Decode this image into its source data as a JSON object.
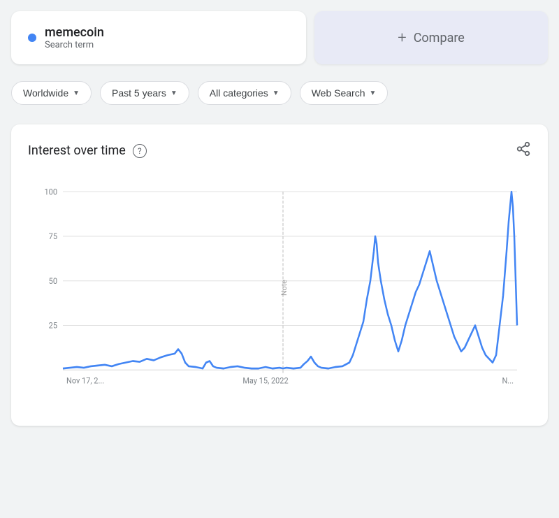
{
  "search_term": {
    "name": "memecoin",
    "label": "Search term",
    "dot_color": "#4285f4"
  },
  "compare": {
    "label": "Compare",
    "plus": "+"
  },
  "filters": [
    {
      "id": "worldwide",
      "label": "Worldwide"
    },
    {
      "id": "past5years",
      "label": "Past 5 years"
    },
    {
      "id": "allcategories",
      "label": "All categories"
    },
    {
      "id": "websearch",
      "label": "Web Search"
    }
  ],
  "chart": {
    "title": "Interest over time",
    "help_label": "?",
    "share_icon": "share",
    "y_labels": [
      "100",
      "75",
      "50",
      "25"
    ],
    "x_labels": [
      "Nov 17, 2...",
      "May 15, 2022",
      "N..."
    ],
    "note_label": "Note",
    "line_color": "#4285f4"
  }
}
